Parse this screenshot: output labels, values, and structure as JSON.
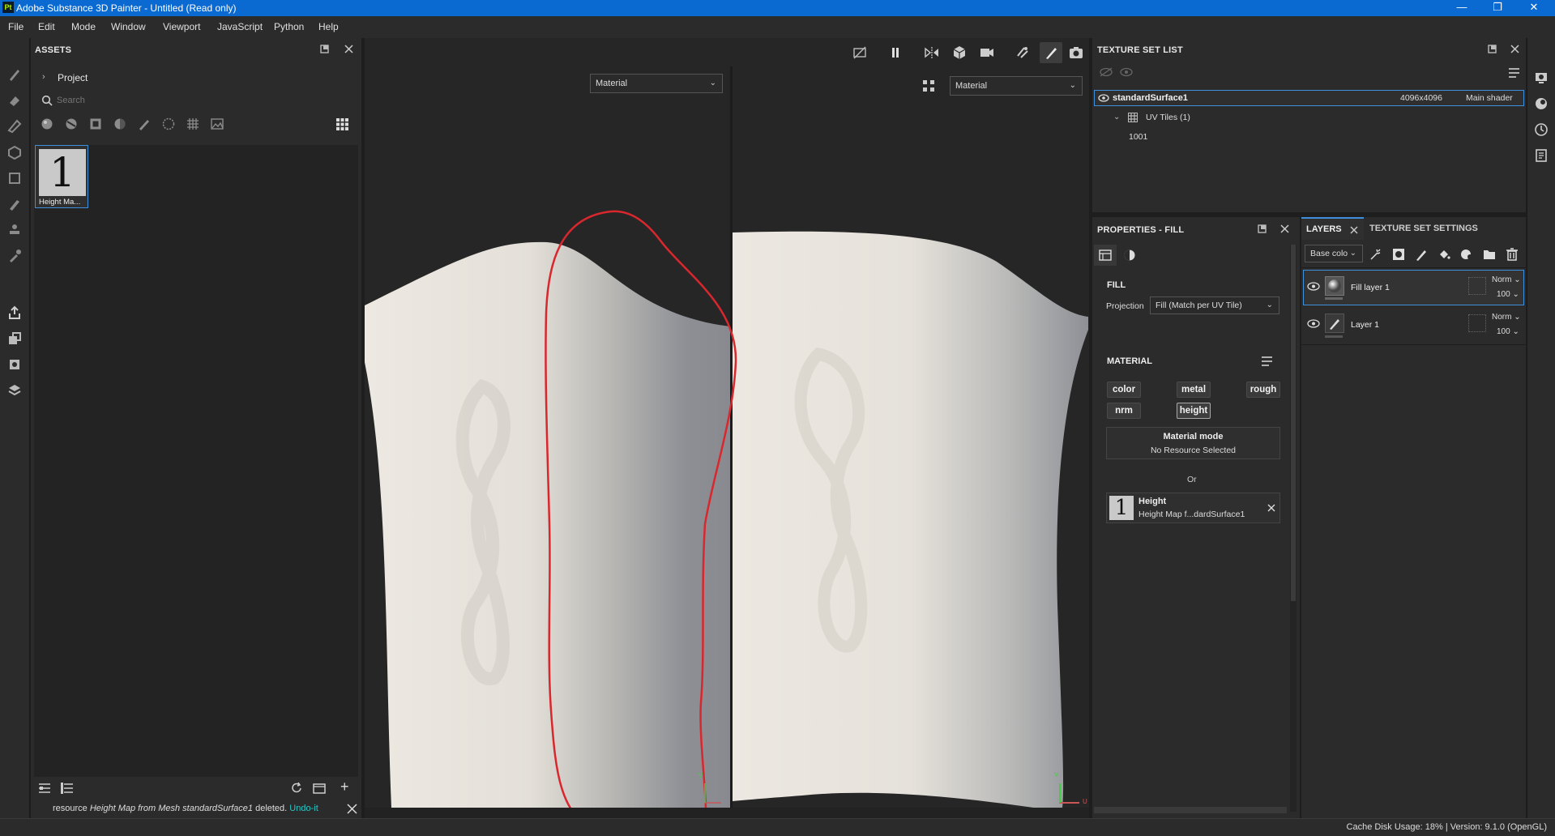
{
  "window": {
    "title": "Adobe Substance 3D Painter - Untitled (Read only)",
    "logo_text": "Pt",
    "controls": {
      "minimize": "—",
      "maximize": "❐",
      "close": "✕"
    }
  },
  "menu": [
    "File",
    "Edit",
    "Mode",
    "Window",
    "Viewport",
    "JavaScript",
    "Python",
    "Help"
  ],
  "assets": {
    "title": "ASSETS",
    "project_label": "Project",
    "search_placeholder": "Search",
    "item": {
      "thumb_text": "1",
      "caption": "Height Ma..."
    },
    "status": {
      "prefix": "resource",
      "message_italic": "Height Map from Mesh standardSurface1",
      "suffix": "deleted.",
      "link": "Undo-it"
    }
  },
  "viewport": {
    "left_mode": "Material",
    "right_mode": "Material",
    "axis_left": {
      "v": "V",
      "u": "U"
    },
    "axis_right": {
      "v": "V",
      "u": "U"
    }
  },
  "texture_set_list": {
    "title": "TEXTURE SET LIST",
    "set": {
      "name": "standardSurface1",
      "resolution": "4096x4096",
      "shader": "Main shader"
    },
    "uv_tiles_label": "UV Tiles (1)",
    "tile": "1001"
  },
  "properties": {
    "title": "PROPERTIES - FILL",
    "fill_section": "FILL",
    "projection_label": "Projection",
    "projection_value": "Fill (Match per UV Tile)",
    "material_section": "MATERIAL",
    "channels": [
      {
        "label": "color",
        "active": false
      },
      {
        "label": "metal",
        "active": false
      },
      {
        "label": "rough",
        "active": false
      },
      {
        "label": "nrm",
        "active": false
      },
      {
        "label": "height",
        "active": true
      }
    ],
    "material_mode_title": "Material mode",
    "material_mode_value": "No Resource Selected",
    "or_label": "Or",
    "height_resource": {
      "thumb_text": "1",
      "title": "Height",
      "name": "Height Map f...dardSurface1"
    }
  },
  "layers": {
    "tab_layers": "LAYERS",
    "tab_tss": "TEXTURE SET SETTINGS",
    "channel_select": "Base colo",
    "items": [
      {
        "name": "Fill layer 1",
        "blend": "Norm",
        "opacity": "100",
        "selected": true
      },
      {
        "name": "Layer 1",
        "blend": "Norm",
        "opacity": "100",
        "selected": false
      }
    ]
  },
  "statusbar": {
    "cache_label": "Cache Disk Usage:",
    "cache_value": "18%",
    "version": "| Version: 9.1.0 (OpenGL)"
  },
  "colors": {
    "accent": "#3f8fdc",
    "title_bar": "#0a6ad1",
    "panel_bg": "#2b2b2b",
    "annotation_red": "#d9272e",
    "link_teal": "#2ec4c4"
  }
}
